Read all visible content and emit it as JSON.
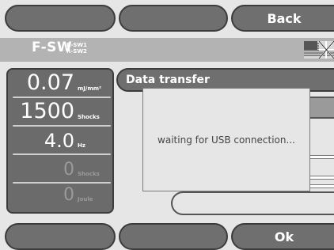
{
  "top_buttons": {
    "left_label": "",
    "middle_label": "",
    "back_label": "Back"
  },
  "header": {
    "logo": "F-SW",
    "sub_line1": "R-SW1",
    "sub_line2": "R-SW2",
    "flag_icon": "uk-flag-icon"
  },
  "readouts": [
    {
      "value": "0.07",
      "unit": "mJ/mm²"
    },
    {
      "value": "1500",
      "unit": "Shocks"
    },
    {
      "value": "4.0",
      "unit": "Hz"
    },
    {
      "value": "0",
      "unit": "Shocks"
    },
    {
      "value": "0",
      "unit": "Joule"
    }
  ],
  "tab": {
    "label": "Data transfer"
  },
  "dialog": {
    "message": "waiting for USB connection..."
  },
  "bottom_buttons": {
    "left_label": "",
    "middle_label": "",
    "ok_label": "Ok"
  },
  "colors": {
    "button": "#6f6f6f",
    "header": "#b3b3b3",
    "background": "#e6e6e6"
  }
}
